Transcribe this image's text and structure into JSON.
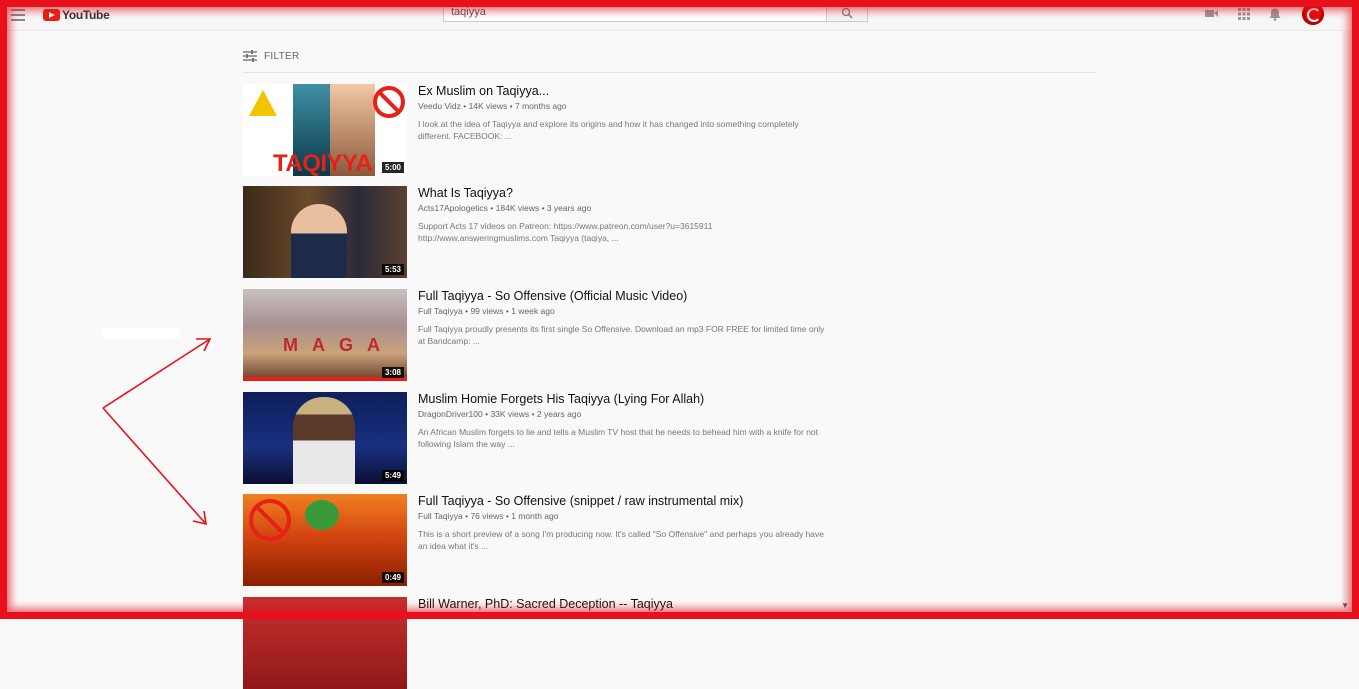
{
  "header": {
    "logo_text": "YouTube",
    "search_value": "taqiyya"
  },
  "filter": {
    "label": "FILTER"
  },
  "results": [
    {
      "title": "Ex Muslim on Taqiyya...",
      "channel": "Veedu Vidz",
      "views": "14K views",
      "age": "7 months ago",
      "description": "I look at the idea of Taqiyya and explore its origins and how it has changed into something completely different. FACEBOOK: ...",
      "duration": "5:00",
      "thumb_text": "TAQIYYA"
    },
    {
      "title": "What Is Taqiyya?",
      "channel": "Acts17Apologetics",
      "views": "184K views",
      "age": "3 years ago",
      "description": "Support Acts 17 videos on Patreon: https://www.patreon.com/user?u=3615911 http://www.answeringmuslims.com Taqiyya (taqiya, ...",
      "duration": "5:53"
    },
    {
      "title": "Full Taqiyya - So Offensive (Official Music Video)",
      "channel": "Full Taqiyya",
      "views": "99 views",
      "age": "1 week ago",
      "description": "Full Taqiyya proudly presents its first single So Offensive. Download an mp3 FOR FREE for limited time only at Bandcamp: ...",
      "duration": "3:08",
      "thumb_text": "MAGA"
    },
    {
      "title": "Muslim Homie Forgets His Taqiyya (Lying For Allah)",
      "channel": "DragonDriver100",
      "views": "33K views",
      "age": "2 years ago",
      "description": "An African Muslim forgets to lie and tells a Muslim TV host that he needs to behead him with a knife for not following Islam the way ...",
      "duration": "5:49"
    },
    {
      "title": "Full Taqiyya - So Offensive (snippet / raw instrumental mix)",
      "channel": "Full Taqiyya",
      "views": "76 views",
      "age": "1 month ago",
      "description": "This is a short preview of a song I'm producing now. It's called \"So Offensive\" and perhaps you already have an idea what it's ...",
      "duration": "0:49"
    },
    {
      "title": "Bill Warner, PhD: Sacred Deception -- Taqiyya"
    }
  ],
  "colors": {
    "brand_red": "#e62117",
    "annotation_red": "#e8101a"
  }
}
